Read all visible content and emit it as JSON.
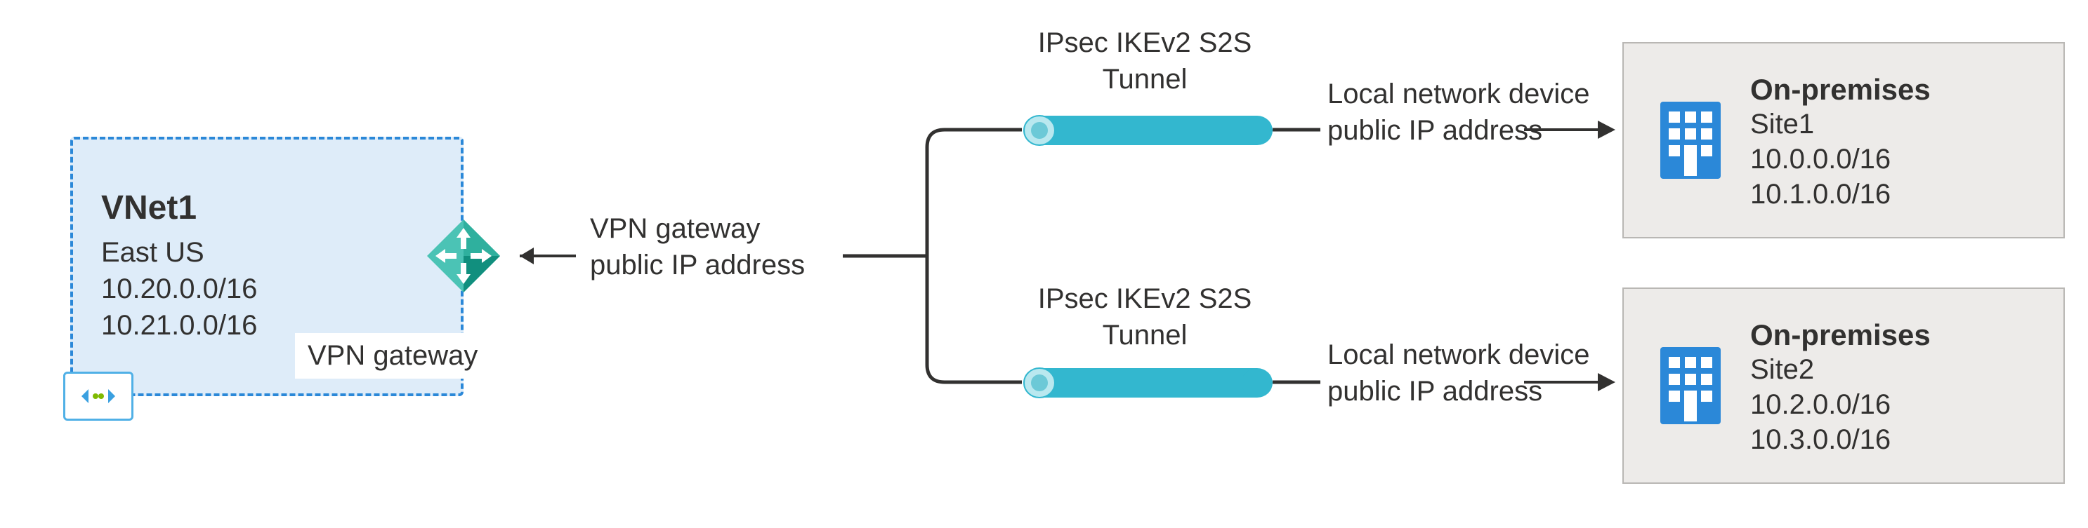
{
  "vnet": {
    "title": "VNet1",
    "region": "East US",
    "cidr1": "10.20.0.0/16",
    "cidr2": "10.21.0.0/16"
  },
  "vpn_gateway_label": "VPN gateway",
  "gateway_ip_label_l1": "VPN gateway",
  "gateway_ip_label_l2": "public IP address",
  "tunnel_label_l1": "IPsec IKEv2 S2S",
  "tunnel_label_l2": "Tunnel",
  "local_device_label_l1": "Local network device",
  "local_device_label_l2": "public IP address",
  "site1": {
    "title": "On-premises",
    "name": "Site1",
    "cidr1": "10.0.0.0/16",
    "cidr2": "10.1.0.0/16"
  },
  "site2": {
    "title": "On-premises",
    "name": "Site2",
    "cidr1": "10.2.0.0/16",
    "cidr2": "10.3.0.0/16"
  },
  "colors": {
    "azure_blue": "#2b88d8",
    "light_blue_fill": "#deecf9",
    "cyan_tunnel": "#33b7cf",
    "site_fill": "#edebe9",
    "site_border": "#b9b7b4",
    "building_icon": "#2b88d8",
    "gateway_teal_light": "#4bc3b5",
    "gateway_teal_dark": "#118f7e"
  }
}
